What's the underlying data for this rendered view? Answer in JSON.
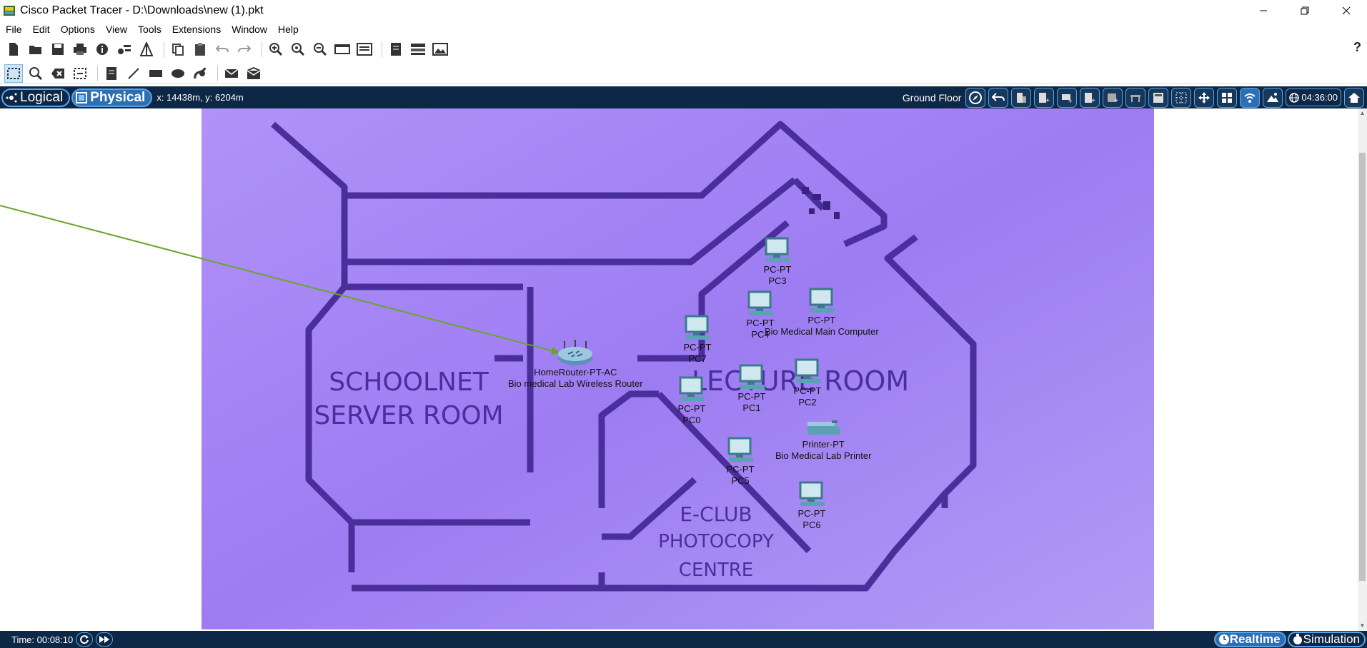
{
  "window": {
    "title": "Cisco Packet Tracer - D:\\Downloads\\new (1).pkt",
    "buttons": [
      "minimize",
      "restore",
      "close"
    ]
  },
  "menu": [
    "File",
    "Edit",
    "Options",
    "View",
    "Tools",
    "Extensions",
    "Window",
    "Help"
  ],
  "toolbar1": [
    "new-icon",
    "open-icon",
    "save-icon",
    "print-icon",
    "info-icon",
    "network-wizard-icon",
    "palette-icon",
    "copy-icon",
    "paste-icon",
    "undo-icon",
    "redo-icon",
    "zoom-in-icon",
    "zoom-reset-icon",
    "zoom-out-icon",
    "drawing-palette-icon",
    "custom-devices-icon",
    "notes-icon",
    "device-template-icon",
    "screenshot-icon"
  ],
  "toolbar2": [
    "select-icon",
    "inspect-icon",
    "delete-icon",
    "resize-icon",
    "note-icon",
    "line-icon",
    "rectangle-icon",
    "ellipse-icon",
    "freeform-icon",
    "simple-pdu-icon",
    "complex-pdu-icon"
  ],
  "help": "?",
  "navbar": {
    "logical_label": "Logical",
    "physical_label": "Physical",
    "coords": "x: 14438m, y: 6204m",
    "floor": "Ground Floor",
    "clock": "04:36:00"
  },
  "floorplan": {
    "background_color": "#a98bf5",
    "line_color": "#4a2f9c",
    "room_labels": {
      "server1": "SCHOOLNET",
      "server2": "SERVER ROOM",
      "lecture": "LECTURE ROOM",
      "eclub1": "E-CLUB",
      "eclub2": "PHOTOCOPY",
      "eclub3": "CENTRE"
    }
  },
  "devices": [
    {
      "id": "router",
      "type": "HomeRouter-PT-AC",
      "name": "Bio medical Lab Wireless Router"
    },
    {
      "id": "pc3",
      "type": "PC-PT",
      "name": "PC3"
    },
    {
      "id": "pc4",
      "type": "PC-PT",
      "name": "PC4"
    },
    {
      "id": "main",
      "type": "PC-PT",
      "name": "Bio Medical Main Computer"
    },
    {
      "id": "pc7",
      "type": "PC-PT",
      "name": "PC7"
    },
    {
      "id": "pc1",
      "type": "PC-PT",
      "name": "PC1"
    },
    {
      "id": "pc2",
      "type": "PC-PT",
      "name": "PC2"
    },
    {
      "id": "pc0",
      "type": "PC-PT",
      "name": "PC0"
    },
    {
      "id": "printer",
      "type": "Printer-PT",
      "name": "Bio Medical Lab Printer"
    },
    {
      "id": "pc5",
      "type": "PC-PT",
      "name": "PC5"
    },
    {
      "id": "pc6",
      "type": "PC-PT",
      "name": "PC6"
    }
  ],
  "link_color": "#6aa52a",
  "status": {
    "time": "Time: 00:08:10",
    "realtime_label": "Realtime",
    "simulation_label": "Simulation"
  }
}
